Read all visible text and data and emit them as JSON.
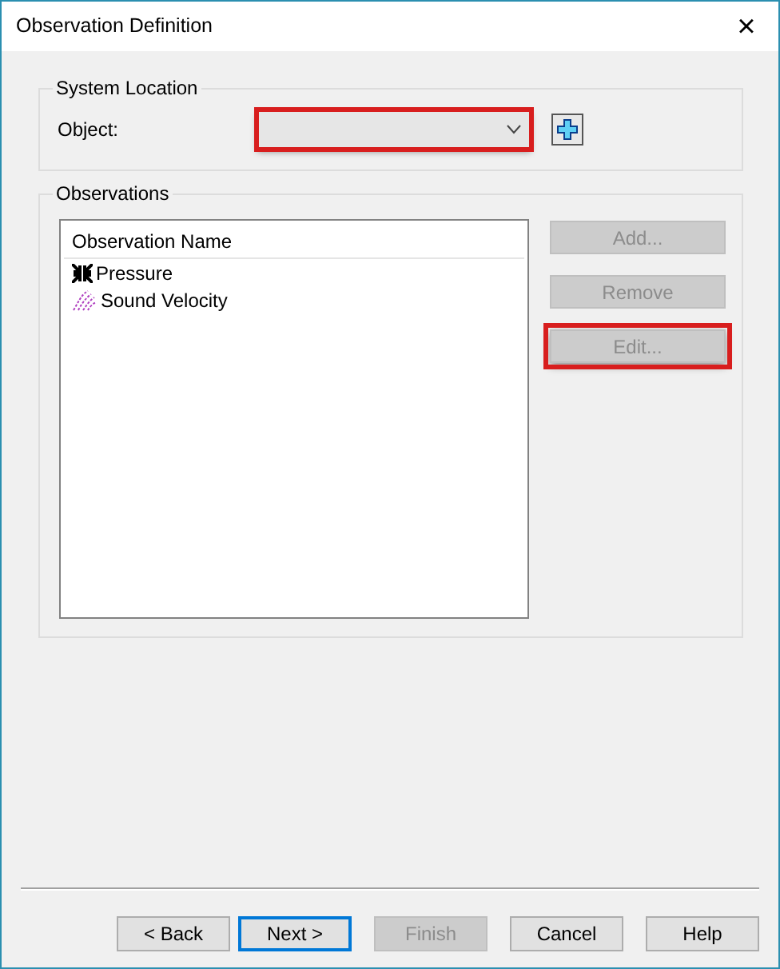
{
  "window": {
    "title": "Observation Definition",
    "close": "×"
  },
  "system_location": {
    "legend": "System Location",
    "label": "Object:",
    "dropdown": {
      "highlighted": true
    }
  },
  "observations": {
    "legend": "Observations",
    "column": "Observation Name",
    "items": [
      {
        "name": "Pressure",
        "kind": "pressure"
      },
      {
        "name": "Sound Velocity",
        "kind": "velocity"
      }
    ],
    "buttons": [
      {
        "label": "Add...",
        "disabled": true,
        "highlighted": false
      },
      {
        "label": "Remove",
        "disabled": true,
        "highlighted": false
      },
      {
        "label": "Edit...",
        "disabled": true,
        "highlighted": true
      }
    ]
  },
  "footer_buttons": [
    {
      "label": "< Back",
      "disabled": false,
      "default": false
    },
    {
      "label": "Next >",
      "disabled": false,
      "default": true
    },
    {
      "label": "Finish",
      "disabled": true,
      "default": false
    },
    {
      "label": "Cancel",
      "disabled": false,
      "default": false
    },
    {
      "label": "Help",
      "disabled": false,
      "default": false
    }
  ]
}
